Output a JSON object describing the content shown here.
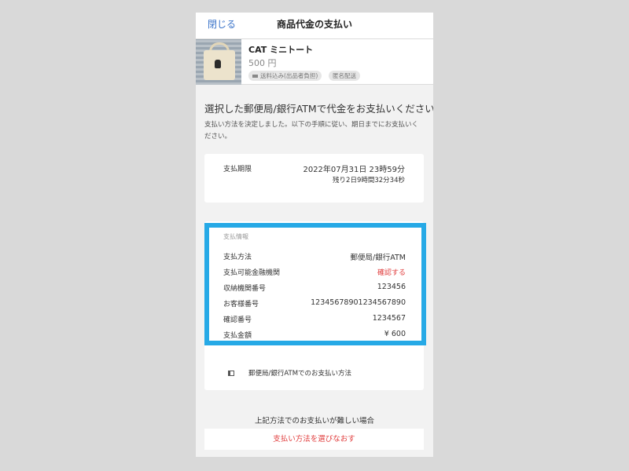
{
  "header": {
    "close_label": "閉じる",
    "title": "商品代金の支払い",
    "link_color": "#3b74c9"
  },
  "product": {
    "name": "CAT ミニトート",
    "price": "500 円",
    "tags": [
      "送料込み(出品者負担)",
      "匿名配送"
    ],
    "thumbnail_icon": "cat-tote-bag-image"
  },
  "main": {
    "heading": "選択した郵便局/銀行ATMで代金をお支払いください",
    "description": "支払い方法を決定しました。以下の手順に従い、期日までにお支払いください。"
  },
  "deadline": {
    "label": "支払期限",
    "date": "2022年07月31日 23時59分",
    "remaining": "残り2日9時間32分34秒"
  },
  "payment_info": {
    "section_label": "支払情報",
    "highlight_color": "#26a9e6",
    "rows": [
      {
        "key": "支払方法",
        "value": "郵便局/銀行ATM"
      },
      {
        "key": "支払可能金融機関",
        "value": "確認する"
      },
      {
        "key": "収納機関番号",
        "value": "123456"
      },
      {
        "key": "お客様番号",
        "value": "12345678901234567890"
      },
      {
        "key": "確認番号",
        "value": "1234567"
      },
      {
        "key": "支払金額",
        "value": "¥ 600"
      }
    ],
    "howto_link": "郵便局/銀行ATMでのお支払い方法",
    "howto_icon": "book-icon"
  },
  "alternative": {
    "heading": "上記方法でのお支払いが難しい場合",
    "button_label": "支払い方法を選びなおす",
    "accent_color": "#e03c3c"
  }
}
